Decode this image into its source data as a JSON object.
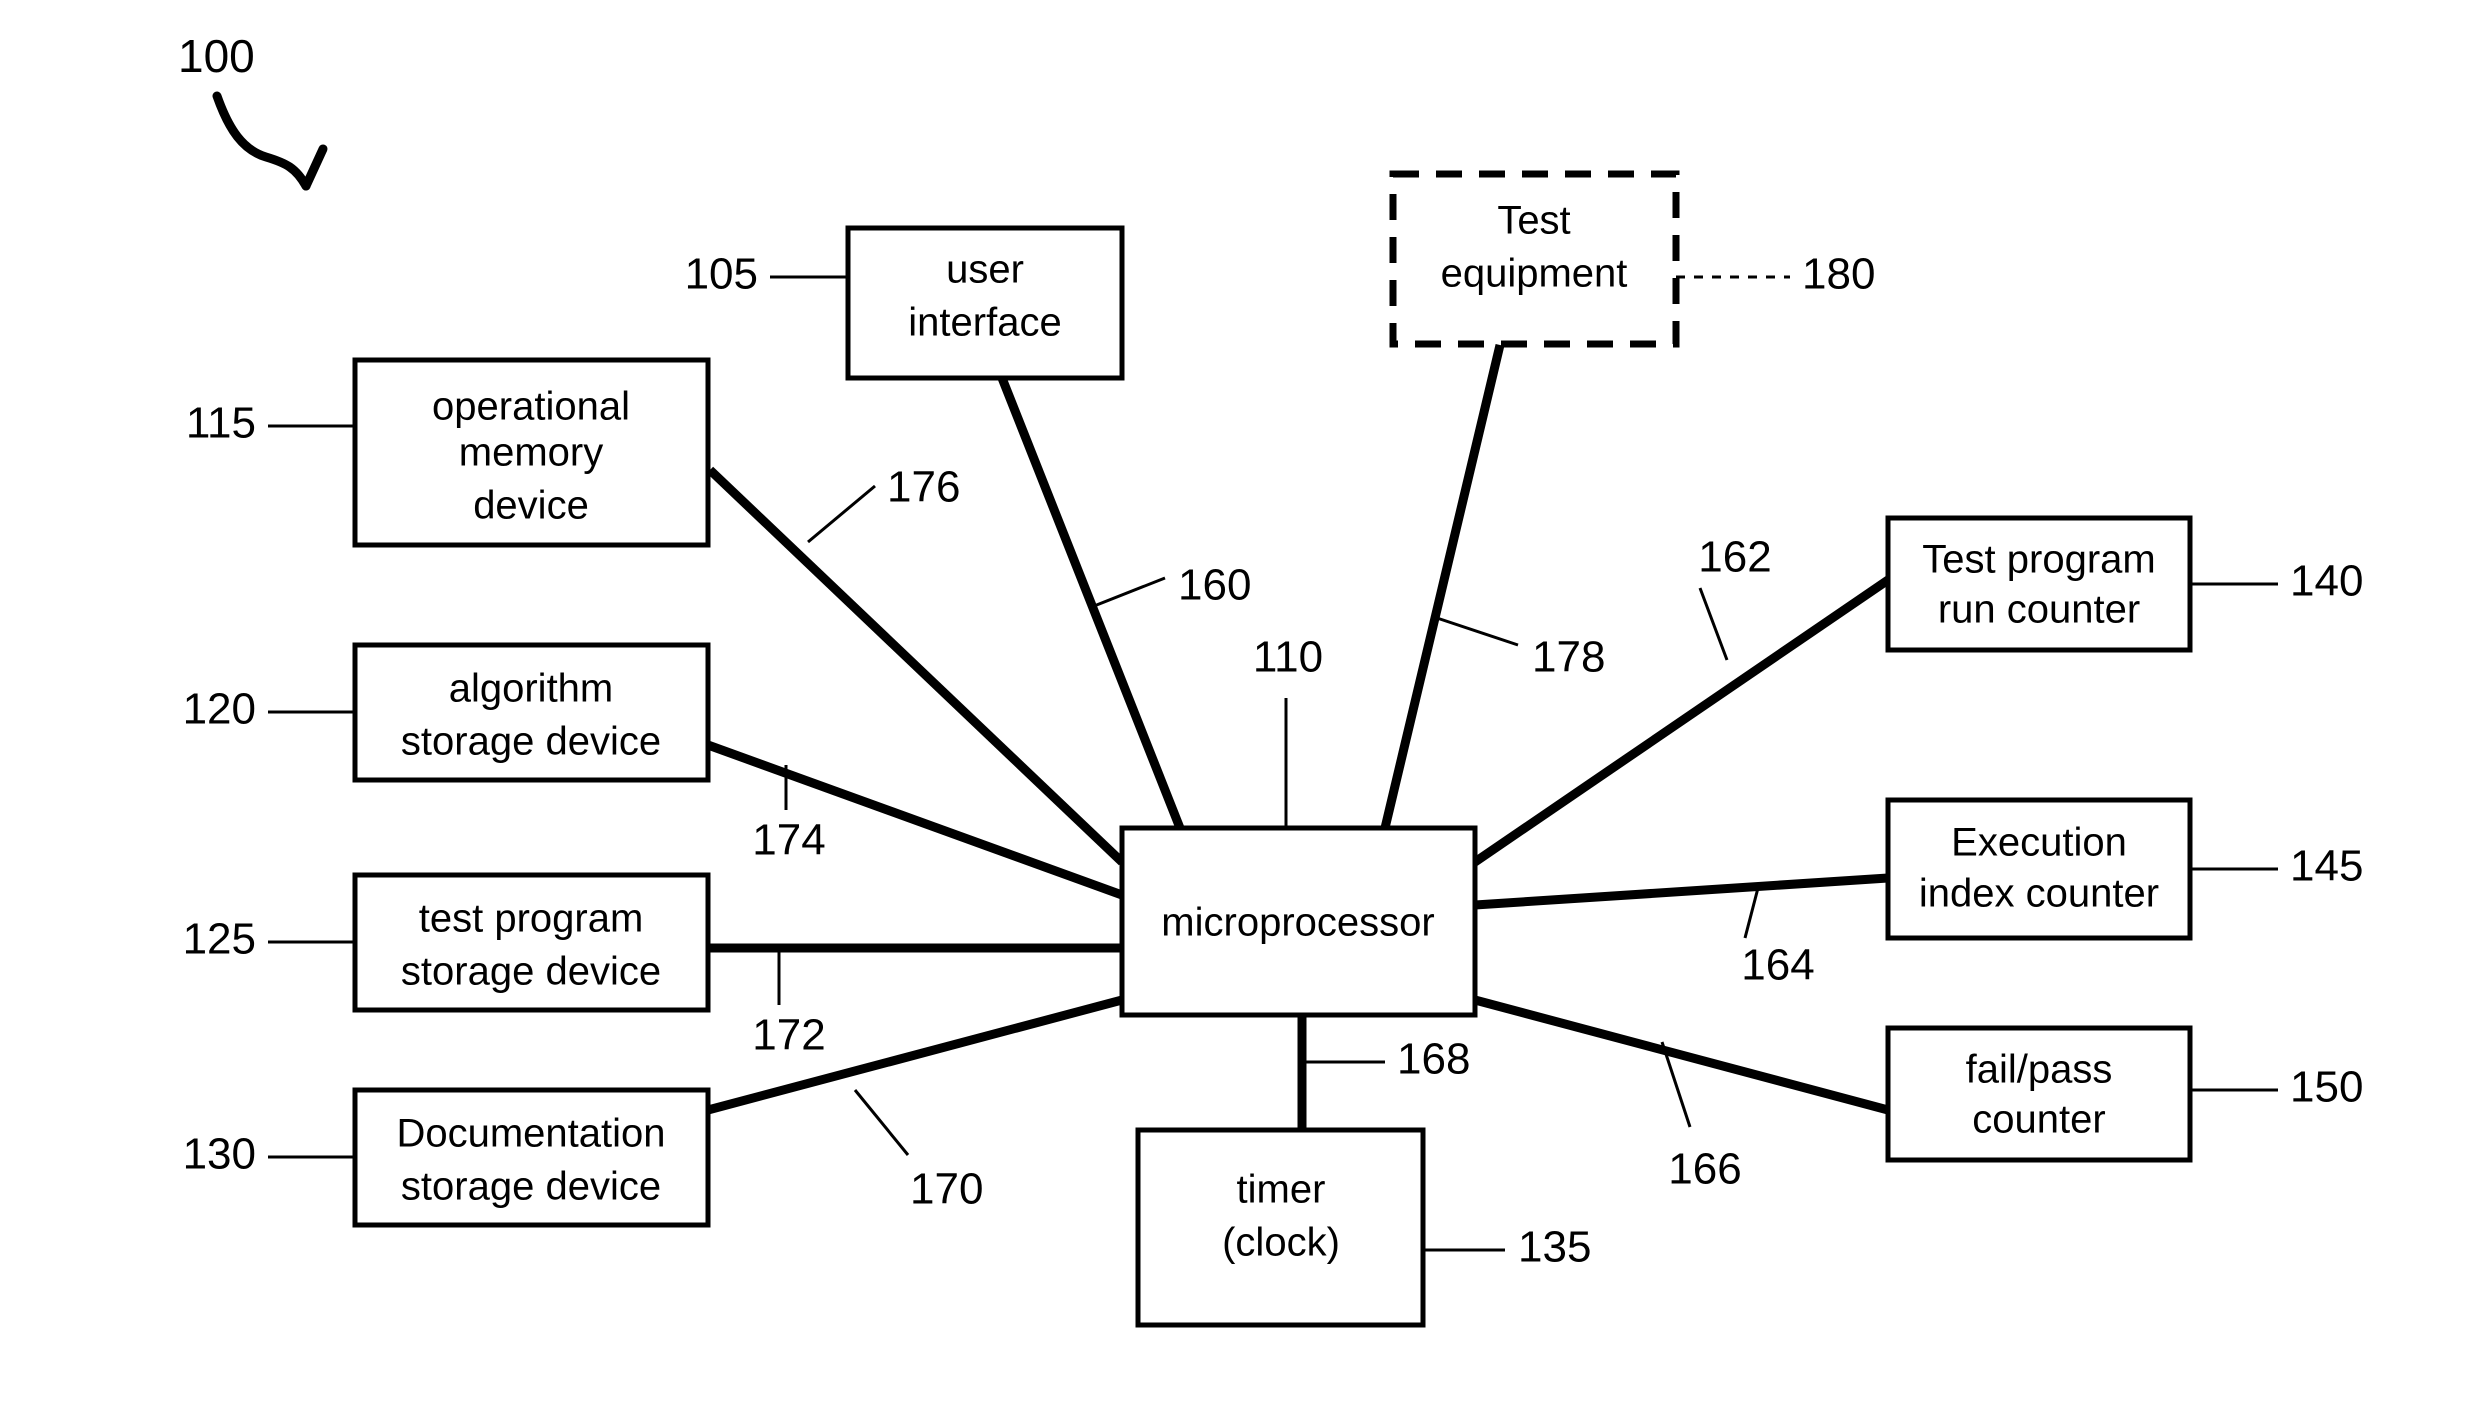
{
  "figure": {
    "figure_number": "100"
  },
  "nodes": [
    {
      "id": "user-interface",
      "label_lines": [
        "user",
        "interface"
      ],
      "ref": "105",
      "style": "solid"
    },
    {
      "id": "test-equipment",
      "label_lines": [
        "Test",
        "equipment"
      ],
      "ref": "180",
      "style": "dashed"
    },
    {
      "id": "operational-memory-device",
      "label_lines": [
        "operational",
        "memory",
        "device"
      ],
      "ref": "115",
      "style": "solid"
    },
    {
      "id": "algorithm-storage-device",
      "label_lines": [
        "algorithm",
        "storage device"
      ],
      "ref": "120",
      "style": "solid"
    },
    {
      "id": "test-program-storage-device",
      "label_lines": [
        "test program",
        "storage device"
      ],
      "ref": "125",
      "style": "solid"
    },
    {
      "id": "documentation-storage-device",
      "label_lines": [
        "Documentation",
        "storage device"
      ],
      "ref": "130",
      "style": "solid"
    },
    {
      "id": "microprocessor",
      "label_lines": [
        "microprocessor"
      ],
      "ref": "110",
      "style": "solid"
    },
    {
      "id": "timer-clock",
      "label_lines": [
        "timer",
        "(clock)"
      ],
      "ref": "135",
      "style": "solid"
    },
    {
      "id": "test-program-run-counter",
      "label_lines": [
        "Test program",
        "run counter"
      ],
      "ref": "140",
      "style": "solid"
    },
    {
      "id": "execution-index-counter",
      "label_lines": [
        "Execution",
        "index counter"
      ],
      "ref": "145",
      "style": "solid"
    },
    {
      "id": "fail-pass-counter",
      "label_lines": [
        "fail/pass",
        "counter"
      ],
      "ref": "150",
      "style": "solid"
    }
  ],
  "connections": [
    {
      "id": "conn-user-interface",
      "ref": "160",
      "from": "user-interface",
      "to": "microprocessor"
    },
    {
      "id": "conn-test-equipment",
      "ref": "178",
      "from": "test-equipment",
      "to": "microprocessor"
    },
    {
      "id": "conn-operational-memory",
      "ref": "176",
      "from": "operational-memory-device",
      "to": "microprocessor"
    },
    {
      "id": "conn-algorithm-storage",
      "ref": "174",
      "from": "algorithm-storage-device",
      "to": "microprocessor"
    },
    {
      "id": "conn-test-program-storage",
      "ref": "172",
      "from": "test-program-storage-device",
      "to": "microprocessor"
    },
    {
      "id": "conn-documentation-storage",
      "ref": "170",
      "from": "documentation-storage-device",
      "to": "microprocessor"
    },
    {
      "id": "conn-timer",
      "ref": "168",
      "from": "microprocessor",
      "to": "timer-clock"
    },
    {
      "id": "conn-test-program-run-counter",
      "ref": "162",
      "from": "microprocessor",
      "to": "test-program-run-counter"
    },
    {
      "id": "conn-execution-index-counter",
      "ref": "164",
      "from": "microprocessor",
      "to": "execution-index-counter"
    },
    {
      "id": "conn-fail-pass-counter",
      "ref": "166",
      "from": "microprocessor",
      "to": "fail-pass-counter"
    }
  ],
  "labels": {
    "n100": "100",
    "n105": "105",
    "n110": "110",
    "n115": "115",
    "n120": "120",
    "n125": "125",
    "n130": "130",
    "n135": "135",
    "n140": "140",
    "n145": "145",
    "n150": "150",
    "n160": "160",
    "n162": "162",
    "n164": "164",
    "n166": "166",
    "n168": "168",
    "n170": "170",
    "n172": "172",
    "n174": "174",
    "n176": "176",
    "n178": "178",
    "n180": "180"
  },
  "text": {
    "ui_l1": "user",
    "ui_l2": "interface",
    "te_l1": "Test",
    "te_l2": "equipment",
    "omd_l1": "operational",
    "omd_l2": "memory",
    "omd_l3": "device",
    "asd_l1": "algorithm",
    "asd_l2": "storage device",
    "tpsd_l1": "test program",
    "tpsd_l2": "storage device",
    "dsd_l1": "Documentation",
    "dsd_l2": "storage device",
    "mp_l1": "microprocessor",
    "tmr_l1": "timer",
    "tmr_l2": "(clock)",
    "tprc_l1": "Test program",
    "tprc_l2": "run counter",
    "eic_l1": "Execution",
    "eic_l2": "index counter",
    "fpc_l1": "fail/pass",
    "fpc_l2": "counter"
  },
  "colors": {
    "stroke": "#000000",
    "background": "#ffffff"
  }
}
